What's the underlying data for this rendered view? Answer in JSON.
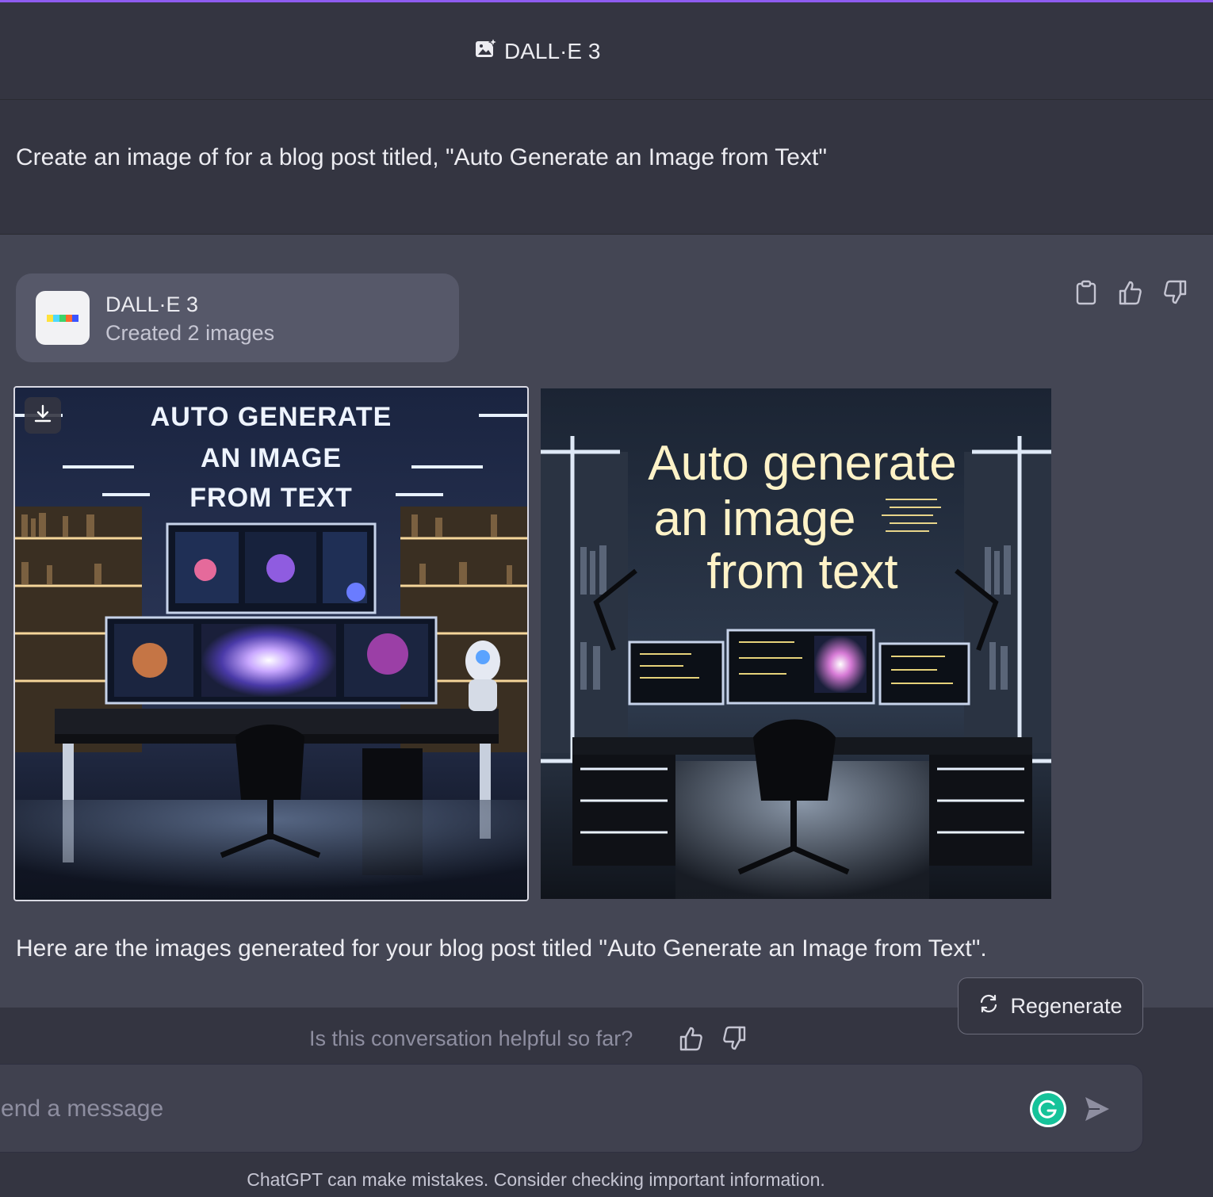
{
  "header": {
    "title": "DALL·E 3"
  },
  "user_message": {
    "text": "Create an image of for a blog post titled, \"Auto Generate an Image from Text\""
  },
  "assistant": {
    "tool_card": {
      "name": "DALL·E 3",
      "status": "Created 2 images"
    },
    "images": [
      {
        "lines": [
          "AUTO GENERATE",
          "AN IMAGE",
          "FROM TEXT"
        ]
      },
      {
        "lines": [
          "Auto generate",
          "an image",
          "from text"
        ]
      }
    ],
    "reply": "Here are the images generated for your blog post titled \"Auto Generate an Image from Text\"."
  },
  "regenerate": {
    "label": "Regenerate"
  },
  "feedback": {
    "prompt": "Is this conversation helpful so far?"
  },
  "composer": {
    "placeholder": "Send a message"
  },
  "disclaimer": "ChatGPT can make mistakes. Consider checking important information.",
  "colors": {
    "accent_top": "#8e5cf0",
    "background": "#343541",
    "assistant_bg": "#444654",
    "grammarly": "#15c39a"
  }
}
